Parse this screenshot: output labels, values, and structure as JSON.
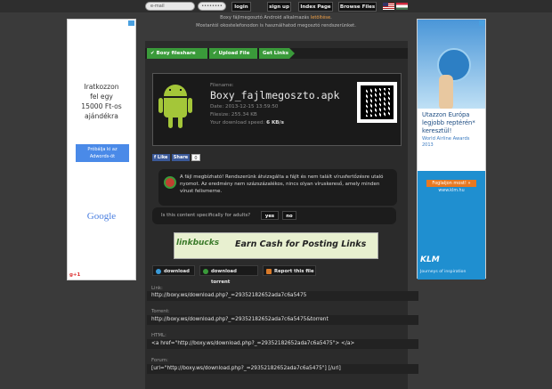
{
  "header": {
    "email_placeholder": "e-mail",
    "password_mask": "••••••••",
    "login": "login",
    "signup": "sign up",
    "index": "Index Page",
    "browse": "Browse Files",
    "notice_pre": "Boxy fájlmegosztó Android alkalmazás ",
    "notice_link": "letöltése",
    "notice_post": ".",
    "notice_line2": "Mostantól okostelefonodon is használhatod megosztó rendszerünket."
  },
  "left_ad": {
    "line1": "Iratkozzon",
    "line2": "fel egy",
    "line3": "15000 Ft-os",
    "line4": "ajándékra",
    "button1": "Próbálja ki az",
    "button2": "Adwords-öt",
    "brand": "Google",
    "gplus": "g+1"
  },
  "right_ad": {
    "line1": "Utazzon Európa",
    "line2": "legjobb reptérén*",
    "line3": "keresztül!",
    "line4": "World Airline Awards",
    "line5": "2013",
    "button": "Foglaljon most! »",
    "url": "www.klm.hu",
    "brand": "KLM",
    "tagline": "Journeys of inspiration"
  },
  "tabs": [
    "Boxy fileshare",
    "Upload File",
    "Get Links"
  ],
  "file": {
    "filename_label": "Filename:",
    "filename": "Boxy_fajlmegoszto.apk",
    "date": "Date: 2013-12-15 13:59:50",
    "size": "Filesize: 255.34 KB",
    "speed_label": "Your download speed: ",
    "speed": "6 KB/s"
  },
  "social": {
    "like": "Like",
    "share": "Share",
    "count": "0"
  },
  "warning": "A fájl megbízható! Rendszerünk átvizsgálta a fájlt és nem talált vírusfertőzésre utaló nyomot. Az eredmény nem százszázalékos, nincs olyan víruskereső, amely minden vírust felismerne.",
  "adult": {
    "question": "Is this content specifically for adults?",
    "yes": "yes",
    "no": "no"
  },
  "banner": {
    "brand": "linkbucks",
    "text": "Earn Cash for Posting Links"
  },
  "downloads": {
    "download": "download",
    "torrent": "download torrent",
    "report": "Report this file"
  },
  "links": [
    {
      "label": "Link:",
      "value": "http://boxy.ws/download.php?_=29352182652ada7c6a5475"
    },
    {
      "label": "Torrent:",
      "value": "http://boxy.ws/download.php?_=29352182652ada7c6a5475&torrent"
    },
    {
      "label": "HTML:",
      "value": "<a href=\"http://boxy.ws/download.php?_=29352182652ada7c6a5475\"> </a>"
    },
    {
      "label": "Forum:",
      "value": "[url=\"http://boxy.ws/download.php?_=29352182652ada7c6a5475\"] [/url]"
    }
  ],
  "colors": {
    "accent_green": "#3a9a3a",
    "speed_highlight": "#f0a048",
    "background": "#3a3a3a"
  }
}
